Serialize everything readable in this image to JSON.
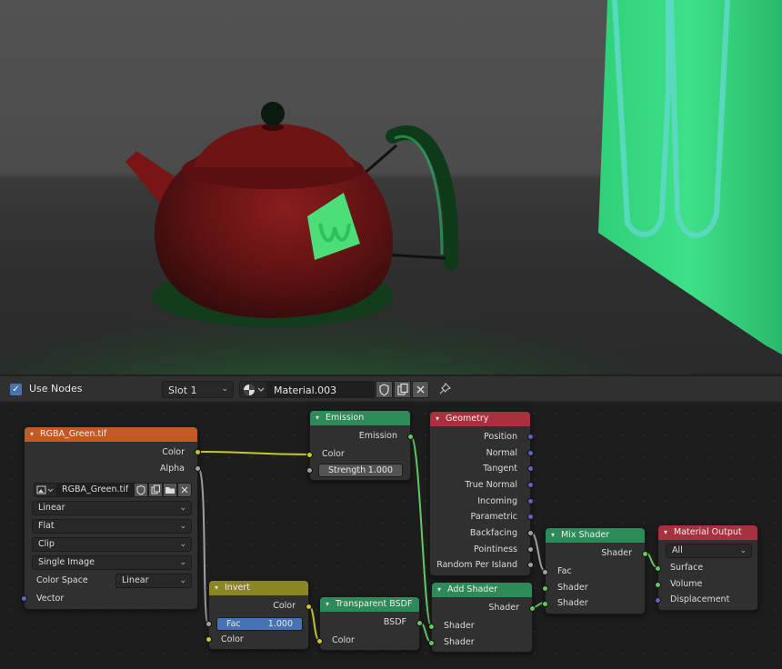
{
  "header": {
    "use_nodes_label": "Use Nodes",
    "use_nodes_checked": true,
    "slot": "Slot 1",
    "material_name": "Material.003",
    "icons": [
      "sphere-material-icon",
      "shield-icon",
      "duplicate-icon",
      "close-icon",
      "pin-icon"
    ]
  },
  "nodes": {
    "image_texture": {
      "title": "RGBA_Green.tif",
      "header_color": "#c05a27",
      "out_color": "Color",
      "out_alpha": "Alpha",
      "image_name": "RGBA_Green.tif",
      "interpolation": "Linear",
      "projection": "Flat",
      "extension": "Clip",
      "source": "Single Image",
      "color_space_label": "Color Space",
      "color_space": "Linear",
      "in_vector": "Vector"
    },
    "emission": {
      "title": "Emission",
      "header_color": "#2f8a5a",
      "out_emission": "Emission",
      "in_color": "Color",
      "strength_label": "Strength",
      "strength_value": "1.000"
    },
    "geometry": {
      "title": "Geometry",
      "header_color": "#a83140",
      "outputs": [
        "Position",
        "Normal",
        "Tangent",
        "True Normal",
        "Incoming",
        "Parametric",
        "Backfacing",
        "Pointiness",
        "Random Per Island"
      ]
    },
    "invert": {
      "title": "Invert",
      "header_color": "#8b8623",
      "out_color": "Color",
      "fac_label": "Fac",
      "fac_value": "1.000",
      "in_color": "Color"
    },
    "transparent": {
      "title": "Transparent BSDF",
      "header_color": "#2f8a5a",
      "out_bsdf": "BSDF",
      "in_color": "Color"
    },
    "add_shader": {
      "title": "Add Shader",
      "header_color": "#2f8a5a",
      "out_shader": "Shader",
      "in_shader_1": "Shader",
      "in_shader_2": "Shader"
    },
    "mix_shader": {
      "title": "Mix Shader",
      "header_color": "#2f8a5a",
      "out_shader": "Shader",
      "in_fac": "Fac",
      "in_shader_1": "Shader",
      "in_shader_2": "Shader"
    },
    "material_output": {
      "title": "Material Output",
      "header_color": "#a83140",
      "target": "All",
      "in_surface": "Surface",
      "in_volume": "Volume",
      "in_displacement": "Displacement"
    }
  }
}
